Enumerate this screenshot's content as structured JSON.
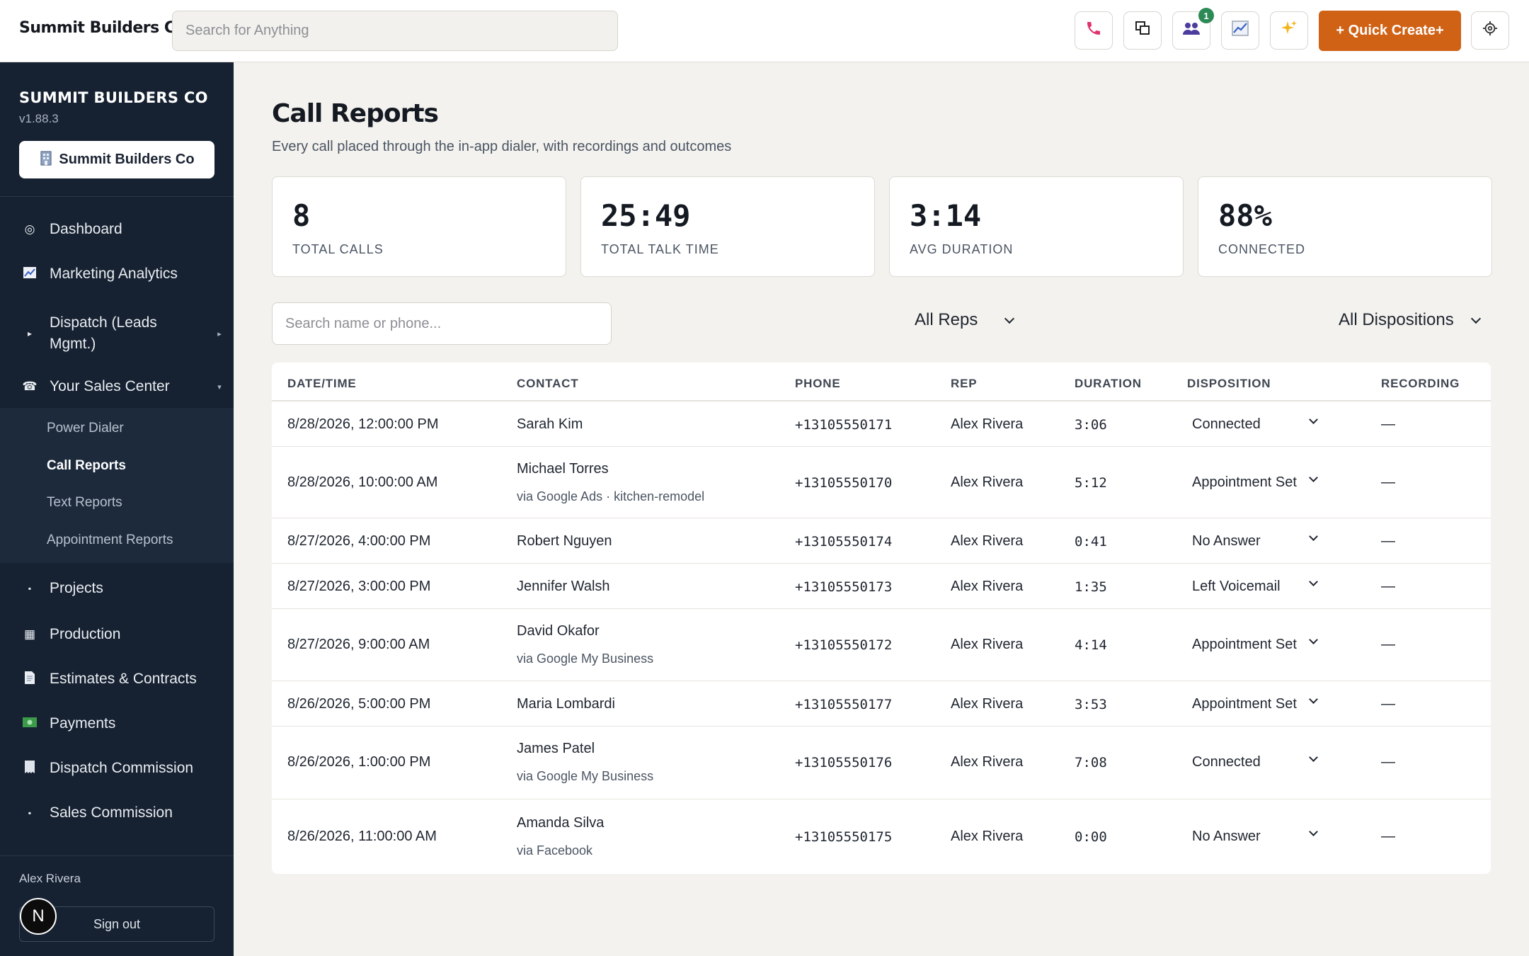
{
  "topbar": {
    "brand": "Summit Builders Co",
    "search_placeholder": "Search for Anything",
    "icons": [
      "phone-icon",
      "windows-icon",
      "team-icon",
      "chart-icon",
      "sparkle-icon",
      "gear-icon"
    ],
    "team_badge": "1",
    "quick_create_label": "+ Quick Create+"
  },
  "sidebar": {
    "org_name": "SUMMIT BUILDERS CO",
    "version": "v1.88.3",
    "org_button_label": "Summit Builders Co",
    "nav": {
      "dashboard": "Dashboard",
      "marketing": "Marketing Analytics",
      "dispatch": "Dispatch (Leads Mgmt.)",
      "sales_center": "Your Sales Center",
      "projects": "Projects",
      "production": "Production",
      "estimates": "Estimates & Contracts",
      "payments": "Payments",
      "dispatch_commission": "Dispatch Commission",
      "sales_commission": "Sales Commission"
    },
    "submenu": {
      "power_dialer": "Power Dialer",
      "call_reports": "Call Reports",
      "text_reports": "Text Reports",
      "appointment_reports": "Appointment Reports"
    },
    "user_name": "Alex Rivera",
    "sign_out_label": "Sign out",
    "avatar_letter": "N"
  },
  "main": {
    "title": "Call Reports",
    "subtitle": "Every call placed through the in-app dialer, with recordings and outcomes",
    "stats": {
      "total_calls": {
        "value": "8",
        "label": "TOTAL CALLS"
      },
      "talk_time": {
        "value": "25:49",
        "label": "TOTAL TALK TIME"
      },
      "avg_duration": {
        "value": "3:14",
        "label": "AVG DURATION"
      },
      "connected": {
        "value": "88%",
        "label": "CONNECTED"
      }
    },
    "filters": {
      "search_placeholder": "Search name or phone...",
      "reps": "All Reps",
      "dispositions": "All Dispositions"
    },
    "table": {
      "headers": {
        "datetime": "DATE/TIME",
        "contact": "CONTACT",
        "phone": "PHONE",
        "rep": "REP",
        "duration": "DURATION",
        "disposition": "DISPOSITION",
        "recording": "RECORDING"
      },
      "rows": [
        {
          "datetime": "8/28/2026, 12:00:00 PM",
          "contact": "Sarah Kim",
          "source": "",
          "phone": "+13105550171",
          "rep": "Alex Rivera",
          "duration": "3:06",
          "disposition": "Connected",
          "recording": "—"
        },
        {
          "datetime": "8/28/2026, 10:00:00 AM",
          "contact": "Michael Torres",
          "source": "via Google Ads · kitchen-remodel",
          "phone": "+13105550170",
          "rep": "Alex Rivera",
          "duration": "5:12",
          "disposition": "Appointment Set",
          "recording": "—"
        },
        {
          "datetime": "8/27/2026, 4:00:00 PM",
          "contact": "Robert Nguyen",
          "source": "",
          "phone": "+13105550174",
          "rep": "Alex Rivera",
          "duration": "0:41",
          "disposition": "No Answer",
          "recording": "—"
        },
        {
          "datetime": "8/27/2026, 3:00:00 PM",
          "contact": "Jennifer Walsh",
          "source": "",
          "phone": "+13105550173",
          "rep": "Alex Rivera",
          "duration": "1:35",
          "disposition": "Left Voicemail",
          "recording": "—"
        },
        {
          "datetime": "8/27/2026, 9:00:00 AM",
          "contact": "David Okafor",
          "source": "via Google My Business",
          "phone": "+13105550172",
          "rep": "Alex Rivera",
          "duration": "4:14",
          "disposition": "Appointment Set",
          "recording": "—"
        },
        {
          "datetime": "8/26/2026, 5:00:00 PM",
          "contact": "Maria Lombardi",
          "source": "",
          "phone": "+13105550177",
          "rep": "Alex Rivera",
          "duration": "3:53",
          "disposition": "Appointment Set",
          "recording": "—"
        },
        {
          "datetime": "8/26/2026, 1:00:00 PM",
          "contact": "James Patel",
          "source": "via Google My Business",
          "phone": "+13105550176",
          "rep": "Alex Rivera",
          "duration": "7:08",
          "disposition": "Connected",
          "recording": "—"
        },
        {
          "datetime": "8/26/2026, 11:00:00 AM",
          "contact": "Amanda Silva",
          "source": "via Facebook",
          "phone": "+13105550175",
          "rep": "Alex Rivera",
          "duration": "0:00",
          "disposition": "No Answer",
          "recording": "—"
        }
      ]
    }
  },
  "colors": {
    "sidebar_bg": "#162131",
    "accent": "#d06216",
    "badge": "#2d8a57",
    "page_bg": "#f3f2ee"
  }
}
